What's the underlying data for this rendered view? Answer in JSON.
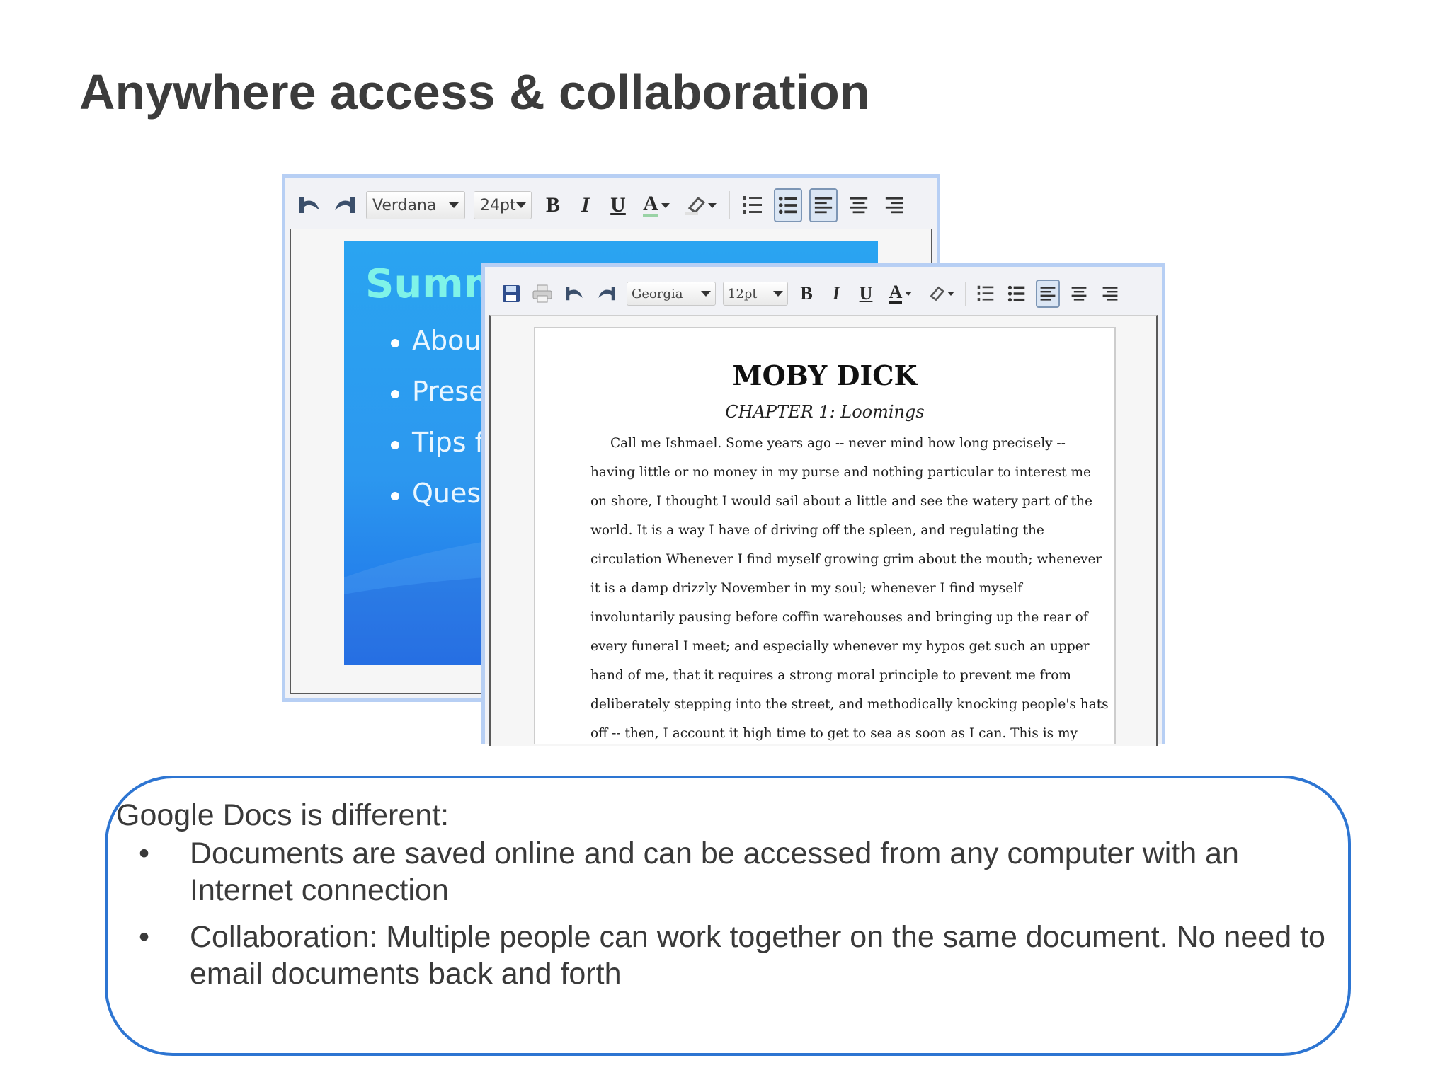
{
  "slide": {
    "title": "Anywhere access & collaboration"
  },
  "back_editor": {
    "toolbar": {
      "font": "Verdana",
      "size": "24pt",
      "bold": "B",
      "italic": "I",
      "underline": "U",
      "text_color": "A"
    },
    "slide_preview": {
      "title": "Summ",
      "bullets": [
        "About",
        "Prese",
        "Tips fo",
        "Quest"
      ]
    }
  },
  "front_editor": {
    "toolbar": {
      "font": "Georgia",
      "size": "12pt",
      "bold": "B",
      "italic": "I",
      "underline": "U",
      "text_color": "A"
    },
    "document": {
      "title": "MOBY DICK",
      "chapter": "CHAPTER 1: Loomings",
      "lines": [
        "Call me Ishmael. Some years ago -- never mind how long precisely --",
        "having little or no money in my purse and nothing particular to interest me",
        "on shore, I thought I would sail about a little and see the watery part of the",
        "world. It is a way I have of driving off the spleen, and regulating the",
        "circulation Whenever I find myself growing grim about the mouth; whenever",
        "it is a damp drizzly November in my soul; whenever I find myself",
        "involuntarily pausing before coffin warehouses and bringing up the rear of",
        "every funeral I meet; and especially whenever my hypos get such an upper",
        "hand of me, that it requires a strong moral principle to prevent me from",
        "deliberately stepping into the street, and methodically knocking people's hats",
        "off -- then, I account it high time to get to sea as soon as I can. This is my"
      ]
    }
  },
  "callout": {
    "heading": "Google Docs is different:",
    "bullet_symbol": "•",
    "items": [
      "Documents are saved online and can be accessed from any computer with an Internet connection",
      "Collaboration: Multiple people can work together on the same document. No need to email documents back and forth"
    ]
  },
  "colors": {
    "callout_border": "#2d75d2",
    "editor_frame": "#b7cff4",
    "slide_preview_bg": "#2c98ef",
    "slide_preview_title": "#7ff3e8"
  },
  "icons": {
    "back_toolbar": [
      "undo-icon",
      "redo-icon",
      "text-color-icon",
      "highlight-icon",
      "numbered-list-icon",
      "bulleted-list-icon",
      "align-left-icon",
      "align-center-icon",
      "align-right-icon"
    ],
    "front_toolbar": [
      "save-icon",
      "print-icon",
      "undo-icon",
      "redo-icon",
      "text-color-icon",
      "highlight-icon",
      "numbered-list-icon",
      "bulleted-list-icon",
      "align-left-icon",
      "align-center-icon",
      "align-right-icon"
    ]
  }
}
